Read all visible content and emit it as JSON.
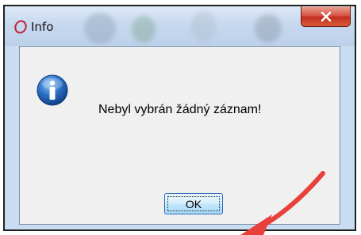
{
  "window": {
    "title": "Info",
    "close_glyph": "X"
  },
  "dialog": {
    "message": "Nebyl vybrán žádný záznam!",
    "icon": "info-icon",
    "ok_label": "OK"
  },
  "annotation": {
    "arrow_color": "#e8413c",
    "points_to": "ok-button"
  },
  "colors": {
    "close_button": "#c3301f",
    "info_icon_blue": "#1f5fb5",
    "focus_button_border": "#2e6bb6"
  }
}
